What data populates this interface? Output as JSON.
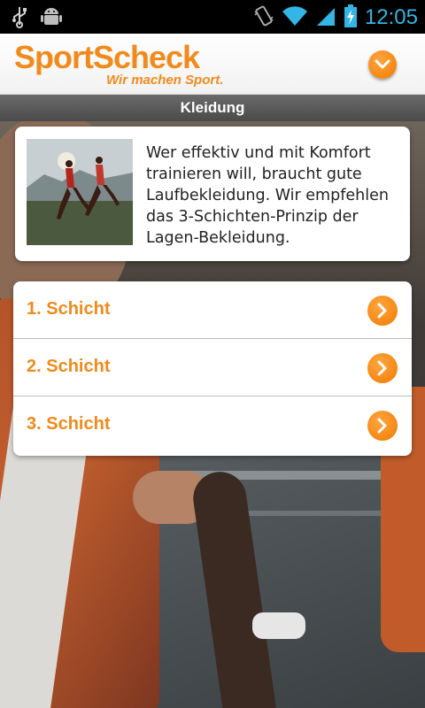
{
  "status_bar": {
    "time": "12:05",
    "icons": [
      "usb-icon",
      "android-debug-icon",
      "vibrate-icon",
      "wifi-icon",
      "signal-icon",
      "battery-charging-icon"
    ]
  },
  "header": {
    "brand": "SportScheck",
    "tagline": "Wir machen Sport.",
    "menu_icon": "chevron-down-icon",
    "accent_color": "#f18a1c"
  },
  "section": {
    "title": "Kleidung"
  },
  "intro": {
    "text": "Wer effektiv und mit Komfort trainieren will, braucht gute Laufbekleidung. Wir empfehlen das 3-Schichten-Prinzip der Lagen-Bekleidung."
  },
  "layers": [
    {
      "label": "1. Schicht"
    },
    {
      "label": "2. Schicht"
    },
    {
      "label": "3. Schicht"
    }
  ]
}
